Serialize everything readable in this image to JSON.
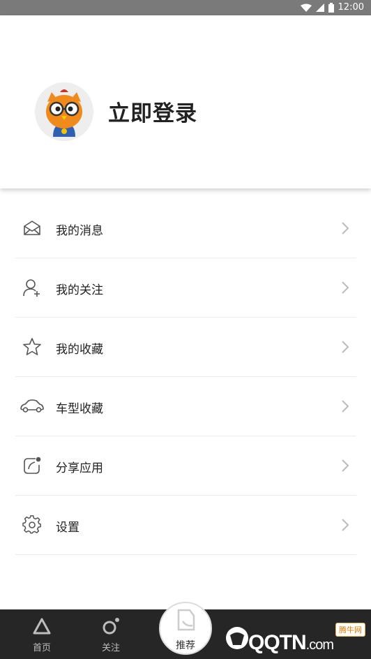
{
  "status_bar": {
    "time": "12:00",
    "wifi_icon": "wifi-icon",
    "signal_icon": "signal-icon",
    "battery_icon": "battery-icon"
  },
  "profile": {
    "login_label": "立即登录",
    "avatar_icon": "owl-mascot-avatar"
  },
  "menu": {
    "items": [
      {
        "label": "我的消息",
        "icon": "mail-icon"
      },
      {
        "label": "我的关注",
        "icon": "user-add-icon"
      },
      {
        "label": "我的收藏",
        "icon": "star-icon"
      },
      {
        "label": "车型收藏",
        "icon": "car-icon"
      },
      {
        "label": "分享应用",
        "icon": "share-icon"
      },
      {
        "label": "设置",
        "icon": "gear-icon"
      }
    ]
  },
  "tab_bar": {
    "tabs": [
      {
        "label": "首页",
        "icon": "triangle-icon"
      },
      {
        "label": "关注",
        "icon": "follow-circle-icon"
      }
    ],
    "center": {
      "label": "推荐",
      "icon": "recommend-icon"
    }
  },
  "watermark": {
    "text": "QQTN",
    "suffix": ".com",
    "badge": "腾牛网"
  },
  "colors": {
    "status_bar": "#7a7a7a",
    "tab_bar": "#262626",
    "divider": "#ececec",
    "watermark_badge": "#e07a00"
  }
}
